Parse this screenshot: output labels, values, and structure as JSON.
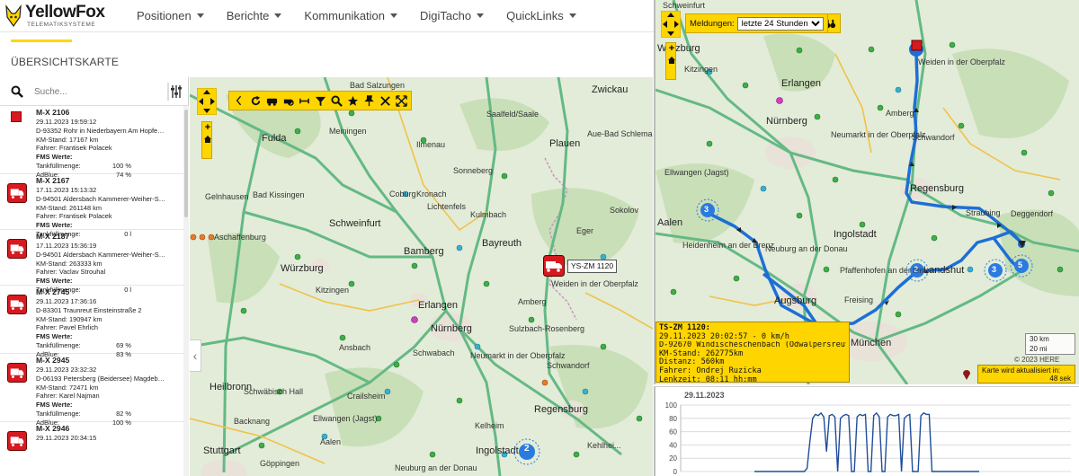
{
  "app": {
    "logo_text": "YellowFox",
    "logo_tagline": "TELEMATIKSYSTEME",
    "page_title": "ÜBERSICHTSKARTE"
  },
  "nav": {
    "items": [
      {
        "label": "Positionen"
      },
      {
        "label": "Berichte"
      },
      {
        "label": "Kommunikation"
      },
      {
        "label": "DigiTacho"
      },
      {
        "label": "QuickLinks"
      }
    ]
  },
  "search": {
    "placeholder": "Suche..."
  },
  "vehicles": [
    {
      "name": "M-X 2106",
      "icon": "stop-square-icon",
      "date": "29.11.2023 19:59:12",
      "address": "D-93352 Rohr in Niederbayern Am Hopfe…",
      "km": "KM-Stand: 17167 km",
      "driver": "Fahrer: Frantisek Polacek",
      "fms": "FMS Werte:",
      "tank_label": "Tankfüllmenge:",
      "tank_value": "100 %",
      "adblue_label": "AdBlue:",
      "adblue_value": "74 %"
    },
    {
      "name": "M-X 2167",
      "icon": "truck-icon",
      "date": "17.11.2023 15:13:32",
      "address": "D-94501 Aldersbach Kammerer-Weiher-S…",
      "km": "KM-Stand: 261148 km",
      "driver": "Fahrer: Frantisek Polacek",
      "fms": "FMS Werte:",
      "tank_label": "Tankfüllmenge:",
      "tank_value": "0 l"
    },
    {
      "name": "M-X 2187",
      "icon": "truck-icon",
      "date": "17.11.2023 15:36:19",
      "address": "D-94501 Aldersbach Kammerer-Weiher-S…",
      "km": "KM-Stand: 263333 km",
      "driver": "Fahrer: Vaclav Strouhal",
      "fms": "FMS Werte:",
      "tank_label": "Tankfüllmenge:",
      "tank_value": "0 l"
    },
    {
      "name": "M-X 2745",
      "icon": "truck-icon",
      "date": "29.11.2023 17:36:16",
      "address": "D-83301 Traunreut Einsteinstraße 2",
      "km": "KM-Stand: 190947 km",
      "driver": "Fahrer: Pavel Ehrlich",
      "fms": "FMS Werte:",
      "tank_label": "Tankfüllmenge:",
      "tank_value": "69 %",
      "adblue_label": "AdBlue:",
      "adblue_value": "83 %"
    },
    {
      "name": "M-X 2945",
      "icon": "truck-icon",
      "date": "29.11.2023 23:32:32",
      "address": "D-06193 Petersberg (Beidersee) Magdeb…",
      "km": "KM-Stand: 72471 km",
      "driver": "Fahrer: Karel Najman",
      "fms": "FMS Werte:",
      "tank_label": "Tankfüllmenge:",
      "tank_value": "82 %",
      "adblue_label": "AdBlue:",
      "adblue_value": "100 %"
    },
    {
      "name": "M-X 2946",
      "icon": "truck-icon",
      "date": "29.11.2023 20:34:15"
    }
  ],
  "left_map": {
    "vehicle_tag": "YS-ZM 1120",
    "cluster_count": "2",
    "place_labels": [
      "Bad Salzungen",
      "Saalfeld/Saale",
      "Zwickau",
      "Fulda",
      "Meiningen",
      "Plauen",
      "Aue-Bad Schlema",
      "Ilmenau",
      "Sonneberg",
      "Sokolov",
      "Bad Kissingen",
      "Coburg",
      "Kronach",
      "Kulmbach",
      "Eger",
      "Gelnhausen",
      "Schweinfurt",
      "Lichtenfels",
      "Bayreuth",
      "Aschaffenburg",
      "Bamberg",
      "Würzburg",
      "Kitzingen",
      "Weiden in der Oberpfalz",
      "Erlangen",
      "Nürnberg",
      "Ansbach",
      "Schwabach",
      "Neumarkt in der Oberpfalz",
      "Schwandorf",
      "Heilbronn",
      "Schwäbisch Hall",
      "Crailsheim",
      "Backnang",
      "Ellwangen (Jagst)",
      "Aalen",
      "Stuttgart",
      "Göppingen",
      "Regensburg",
      "Ingolstadt",
      "Neuburg an der Donau",
      "Kelheim",
      "Amberg",
      "Sulzbach-Rosenberg",
      "Kehlhei..."
    ]
  },
  "right_map": {
    "meldungen_label": "Meldungen:",
    "meldungen_options": [
      "letzte 24 Stunden"
    ],
    "meldungen_selected": "letzte 24 Stunden",
    "clusters": [
      "3",
      "2",
      "3",
      "5"
    ],
    "place_labels": [
      "Schweinfurt",
      "Würzburg",
      "Kitzingen",
      "Erlangen",
      "Nürnberg",
      "Weiden in der Oberpfalz",
      "Amberg",
      "Schwandorf",
      "Neumarkt in der Oberpfalz",
      "Regensburg",
      "Straubing",
      "Deggendorf",
      "Ellwangen (Jagst)",
      "Aalen",
      "Heidenheim an der Brenz",
      "Neuburg an der Donau",
      "Ingolstadt",
      "Landshut",
      "Freising",
      "Pfaffenhofen an der Ilm",
      "Augsburg",
      "München"
    ],
    "info_popup": {
      "title": "TS-ZM 1120:",
      "date": "29.11.2023 20:02:57 - 0 km/h",
      "address": "D-92670 Windischeschenbach (Odwalpersreuth) A93",
      "km": "KM-Stand: 262775km",
      "distance": "Distanz: 560km",
      "driver": "Fahrer: Ondrej Ruzicka",
      "lenkzeit": "Lenkzeit: 08:11 hh:mm"
    },
    "scale_km": "30 km",
    "scale_mi": "20 mi",
    "copyright": "© 2023 HERE",
    "refresh_label": "Karte wird aktualisiert in:",
    "refresh_value": "48 sek"
  },
  "chart_data": {
    "type": "line",
    "title": "29.11.2023",
    "xlabel": "",
    "ylabel": "",
    "ylim": [
      0,
      100
    ],
    "yticks": [
      0,
      20,
      40,
      60,
      80,
      100
    ],
    "grid": true,
    "colors": {
      "line": "#1f4e9a"
    },
    "series": [
      {
        "values": [
          0,
          0,
          0,
          0,
          0,
          0,
          0,
          0,
          0,
          0,
          0,
          0,
          0,
          0,
          0,
          0,
          0,
          0,
          0,
          5,
          45,
          80,
          86,
          84,
          88,
          82,
          30,
          84,
          86,
          82,
          0,
          80,
          84,
          86,
          84,
          0,
          0,
          82,
          86,
          84,
          86,
          0,
          0,
          84,
          88,
          82,
          0,
          0,
          82,
          86,
          84,
          84,
          86,
          0,
          80,
          84,
          86,
          0,
          0,
          0,
          84,
          88,
          86,
          86,
          0,
          0,
          0,
          0,
          0,
          0,
          0,
          0,
          0,
          0,
          0,
          0,
          0,
          0,
          0,
          0,
          0,
          0
        ]
      }
    ]
  }
}
